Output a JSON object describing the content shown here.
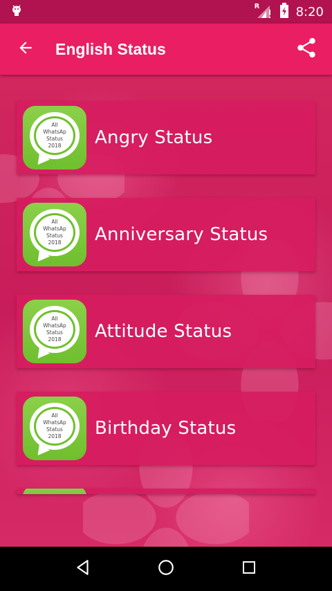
{
  "status_bar": {
    "time": "8:20",
    "signal_label": "R",
    "icons": [
      "android-icon",
      "signal-icon",
      "battery-icon"
    ]
  },
  "app_bar": {
    "title": "English Status",
    "back_icon": "arrow-back-icon",
    "share_icon": "share-icon",
    "color": "#e91e63"
  },
  "app_icon_text": [
    "All",
    "WhatsAp",
    "Status",
    "2018"
  ],
  "items": [
    {
      "label": "Angry Status"
    },
    {
      "label": "Anniversary Status"
    },
    {
      "label": "Attitude Status"
    },
    {
      "label": "Birthday Status"
    }
  ],
  "nav_bar": {
    "icons": [
      "back-triangle-icon",
      "home-circle-icon",
      "recents-square-icon"
    ]
  },
  "colors": {
    "accent": "#e91e63",
    "status_bar": "#b0134f",
    "icon_green": "#6fbf2e"
  }
}
